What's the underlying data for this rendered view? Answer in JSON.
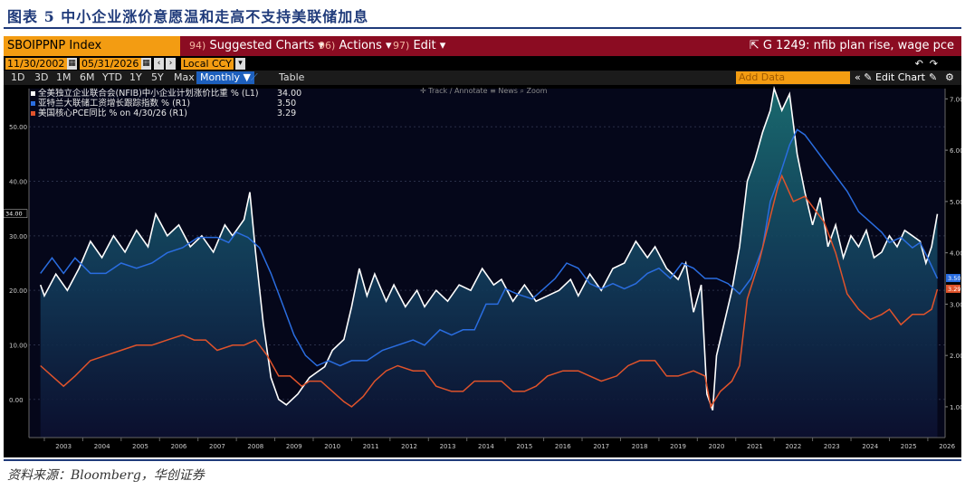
{
  "figure_title": "图表 5 中小企业涨价意愿温和走高不支持美联储加息",
  "source": "资料来源：Bloomberg，华创证券",
  "toolbar": {
    "ticker": "SBOIPPNP Index",
    "menu": [
      {
        "num": "94)",
        "label": "Suggested Charts ▾"
      },
      {
        "num": "96)",
        "label": "Actions ▾"
      },
      {
        "num": "97)",
        "label": "Edit ▾"
      }
    ],
    "chart_id": "G 1249: nfib plan rise, wage pce",
    "start_date": "11/30/2002",
    "end_date": "05/31/2026",
    "currency": "Local CCY",
    "periods": [
      "1D",
      "3D",
      "1M",
      "6M",
      "YTD",
      "1Y",
      "5Y",
      "Max"
    ],
    "frequency": "Monthly ▼",
    "table_label": "Table",
    "add_data": "Add Data",
    "edit_chart": "« ✎ Edit Chart",
    "tools": "✛ Track   ∕ Annotate   ≡ News   ⌕ Zoom"
  },
  "chart_data": {
    "type": "line",
    "x_unit": "date",
    "x_ticks": [
      "2003",
      "2004",
      "2005",
      "2006",
      "2007",
      "2008",
      "2009",
      "2010",
      "2011",
      "2012",
      "2013",
      "2014",
      "2015",
      "2016",
      "2017",
      "2018",
      "2019",
      "2020",
      "2021",
      "2022",
      "2023",
      "2024",
      "2025",
      "2026"
    ],
    "y_left": {
      "ticks": [
        "0.00",
        "10.00",
        "20.00",
        "30.00",
        "40.00",
        "50.00"
      ],
      "range": [
        -7,
        57
      ]
    },
    "y_right": {
      "ticks": [
        "1.00",
        "2.00",
        "3.00",
        "4.00",
        "5.00",
        "6.00",
        "7.00"
      ],
      "range": [
        0.4,
        7.2
      ]
    },
    "series": [
      {
        "name": "全美独立企业联合会(NFIB)中小企业计划涨价比重 % (L1)",
        "last": "34.00",
        "axis": "left",
        "color": "#ffffff",
        "area": true,
        "points": [
          [
            2002.9,
            21
          ],
          [
            2003.0,
            19
          ],
          [
            2003.3,
            23
          ],
          [
            2003.6,
            20
          ],
          [
            2003.9,
            24
          ],
          [
            2004.2,
            29
          ],
          [
            2004.5,
            26
          ],
          [
            2004.8,
            30
          ],
          [
            2005.1,
            27
          ],
          [
            2005.4,
            31
          ],
          [
            2005.7,
            28
          ],
          [
            2005.9,
            34
          ],
          [
            2006.2,
            30
          ],
          [
            2006.5,
            32
          ],
          [
            2006.8,
            28
          ],
          [
            2007.1,
            30
          ],
          [
            2007.4,
            27
          ],
          [
            2007.7,
            32
          ],
          [
            2007.9,
            30
          ],
          [
            2008.2,
            33
          ],
          [
            2008.35,
            38
          ],
          [
            2008.5,
            27
          ],
          [
            2008.7,
            14
          ],
          [
            2008.9,
            4
          ],
          [
            2009.1,
            0
          ],
          [
            2009.3,
            -1
          ],
          [
            2009.6,
            1
          ],
          [
            2009.9,
            4
          ],
          [
            2010.1,
            5
          ],
          [
            2010.3,
            6
          ],
          [
            2010.5,
            9
          ],
          [
            2010.8,
            11
          ],
          [
            2011.0,
            17
          ],
          [
            2011.2,
            24
          ],
          [
            2011.4,
            19
          ],
          [
            2011.6,
            23
          ],
          [
            2011.9,
            18
          ],
          [
            2012.1,
            21
          ],
          [
            2012.4,
            17
          ],
          [
            2012.7,
            20
          ],
          [
            2012.9,
            17
          ],
          [
            2013.2,
            20
          ],
          [
            2013.5,
            18
          ],
          [
            2013.8,
            21
          ],
          [
            2014.1,
            20
          ],
          [
            2014.4,
            24
          ],
          [
            2014.7,
            21
          ],
          [
            2014.9,
            22
          ],
          [
            2015.2,
            18
          ],
          [
            2015.5,
            21
          ],
          [
            2015.8,
            18
          ],
          [
            2016.1,
            19
          ],
          [
            2016.4,
            20
          ],
          [
            2016.7,
            22
          ],
          [
            2016.9,
            19
          ],
          [
            2017.2,
            23
          ],
          [
            2017.5,
            20
          ],
          [
            2017.8,
            24
          ],
          [
            2018.1,
            25
          ],
          [
            2018.4,
            29
          ],
          [
            2018.7,
            26
          ],
          [
            2018.9,
            28
          ],
          [
            2019.2,
            24
          ],
          [
            2019.5,
            22
          ],
          [
            2019.7,
            25
          ],
          [
            2019.9,
            16
          ],
          [
            2020.1,
            21
          ],
          [
            2020.25,
            1
          ],
          [
            2020.4,
            -2
          ],
          [
            2020.5,
            8
          ],
          [
            2020.7,
            14
          ],
          [
            2020.9,
            20
          ],
          [
            2021.1,
            28
          ],
          [
            2021.3,
            40
          ],
          [
            2021.5,
            44
          ],
          [
            2021.7,
            49
          ],
          [
            2021.9,
            53
          ],
          [
            2022.0,
            57
          ],
          [
            2022.2,
            53
          ],
          [
            2022.4,
            56
          ],
          [
            2022.6,
            45
          ],
          [
            2022.8,
            38
          ],
          [
            2023.0,
            32
          ],
          [
            2023.2,
            37
          ],
          [
            2023.4,
            28
          ],
          [
            2023.6,
            32
          ],
          [
            2023.8,
            26
          ],
          [
            2024.0,
            30
          ],
          [
            2024.2,
            28
          ],
          [
            2024.4,
            31
          ],
          [
            2024.6,
            26
          ],
          [
            2024.8,
            27
          ],
          [
            2025.0,
            30
          ],
          [
            2025.2,
            28
          ],
          [
            2025.4,
            31
          ],
          [
            2025.6,
            30
          ],
          [
            2025.8,
            29
          ],
          [
            2025.95,
            25
          ],
          [
            2026.1,
            28
          ],
          [
            2026.25,
            34
          ]
        ]
      },
      {
        "name": "亚特兰大联储工资增长跟踪指数 % (R1)",
        "last": "3.50",
        "axis": "right",
        "color": "#2a6de0",
        "points": [
          [
            2002.9,
            3.6
          ],
          [
            2003.2,
            3.9
          ],
          [
            2003.5,
            3.6
          ],
          [
            2003.8,
            3.9
          ],
          [
            2004.2,
            3.6
          ],
          [
            2004.6,
            3.6
          ],
          [
            2005.0,
            3.8
          ],
          [
            2005.4,
            3.7
          ],
          [
            2005.8,
            3.8
          ],
          [
            2006.2,
            4.0
          ],
          [
            2006.6,
            4.1
          ],
          [
            2007.0,
            4.3
          ],
          [
            2007.5,
            4.3
          ],
          [
            2007.8,
            4.2
          ],
          [
            2008.0,
            4.4
          ],
          [
            2008.3,
            4.3
          ],
          [
            2008.6,
            4.1
          ],
          [
            2008.9,
            3.6
          ],
          [
            2009.2,
            3.0
          ],
          [
            2009.5,
            2.4
          ],
          [
            2009.8,
            2.0
          ],
          [
            2010.1,
            1.8
          ],
          [
            2010.4,
            1.9
          ],
          [
            2010.7,
            1.8
          ],
          [
            2011.0,
            1.9
          ],
          [
            2011.4,
            1.9
          ],
          [
            2011.8,
            2.1
          ],
          [
            2012.2,
            2.2
          ],
          [
            2012.6,
            2.3
          ],
          [
            2012.9,
            2.2
          ],
          [
            2013.3,
            2.5
          ],
          [
            2013.6,
            2.4
          ],
          [
            2013.9,
            2.5
          ],
          [
            2014.2,
            2.5
          ],
          [
            2014.5,
            3.0
          ],
          [
            2014.8,
            3.0
          ],
          [
            2015.0,
            3.3
          ],
          [
            2015.3,
            3.2
          ],
          [
            2015.7,
            3.1
          ],
          [
            2016.0,
            3.3
          ],
          [
            2016.3,
            3.5
          ],
          [
            2016.6,
            3.8
          ],
          [
            2016.9,
            3.7
          ],
          [
            2017.2,
            3.4
          ],
          [
            2017.5,
            3.3
          ],
          [
            2017.8,
            3.4
          ],
          [
            2018.1,
            3.3
          ],
          [
            2018.4,
            3.4
          ],
          [
            2018.7,
            3.6
          ],
          [
            2019.0,
            3.7
          ],
          [
            2019.3,
            3.5
          ],
          [
            2019.6,
            3.8
          ],
          [
            2019.9,
            3.7
          ],
          [
            2020.2,
            3.5
          ],
          [
            2020.5,
            3.5
          ],
          [
            2020.8,
            3.4
          ],
          [
            2021.1,
            3.2
          ],
          [
            2021.4,
            3.5
          ],
          [
            2021.7,
            4.1
          ],
          [
            2021.9,
            5.0
          ],
          [
            2022.1,
            5.4
          ],
          [
            2022.4,
            6.1
          ],
          [
            2022.6,
            6.4
          ],
          [
            2022.8,
            6.3
          ],
          [
            2023.0,
            6.1
          ],
          [
            2023.3,
            5.8
          ],
          [
            2023.6,
            5.5
          ],
          [
            2023.9,
            5.2
          ],
          [
            2024.2,
            4.8
          ],
          [
            2024.5,
            4.6
          ],
          [
            2024.8,
            4.4
          ],
          [
            2025.0,
            4.2
          ],
          [
            2025.3,
            4.3
          ],
          [
            2025.6,
            4.1
          ],
          [
            2025.8,
            4.2
          ],
          [
            2026.0,
            3.9
          ],
          [
            2026.25,
            3.5
          ]
        ]
      },
      {
        "name": "美国核心PCE同比 % on 4/30/26 (R1)",
        "last": "3.29",
        "axis": "right",
        "color": "#e0532b",
        "points": [
          [
            2002.9,
            1.8
          ],
          [
            2003.2,
            1.6
          ],
          [
            2003.5,
            1.4
          ],
          [
            2003.8,
            1.6
          ],
          [
            2004.2,
            1.9
          ],
          [
            2004.6,
            2.0
          ],
          [
            2005.0,
            2.1
          ],
          [
            2005.4,
            2.2
          ],
          [
            2005.8,
            2.2
          ],
          [
            2006.2,
            2.3
          ],
          [
            2006.6,
            2.4
          ],
          [
            2006.9,
            2.3
          ],
          [
            2007.2,
            2.3
          ],
          [
            2007.5,
            2.1
          ],
          [
            2007.9,
            2.2
          ],
          [
            2008.2,
            2.2
          ],
          [
            2008.5,
            2.3
          ],
          [
            2008.8,
            2.0
          ],
          [
            2009.1,
            1.6
          ],
          [
            2009.4,
            1.6
          ],
          [
            2009.7,
            1.4
          ],
          [
            2009.9,
            1.5
          ],
          [
            2010.2,
            1.5
          ],
          [
            2010.5,
            1.3
          ],
          [
            2010.8,
            1.1
          ],
          [
            2011.0,
            1.0
          ],
          [
            2011.3,
            1.2
          ],
          [
            2011.6,
            1.5
          ],
          [
            2011.9,
            1.7
          ],
          [
            2012.2,
            1.8
          ],
          [
            2012.6,
            1.7
          ],
          [
            2012.9,
            1.7
          ],
          [
            2013.2,
            1.4
          ],
          [
            2013.6,
            1.3
          ],
          [
            2013.9,
            1.3
          ],
          [
            2014.2,
            1.5
          ],
          [
            2014.6,
            1.5
          ],
          [
            2014.9,
            1.5
          ],
          [
            2015.2,
            1.3
          ],
          [
            2015.5,
            1.3
          ],
          [
            2015.8,
            1.4
          ],
          [
            2016.1,
            1.6
          ],
          [
            2016.5,
            1.7
          ],
          [
            2016.9,
            1.7
          ],
          [
            2017.2,
            1.6
          ],
          [
            2017.5,
            1.5
          ],
          [
            2017.9,
            1.6
          ],
          [
            2018.2,
            1.8
          ],
          [
            2018.5,
            1.9
          ],
          [
            2018.9,
            1.9
          ],
          [
            2019.2,
            1.6
          ],
          [
            2019.5,
            1.6
          ],
          [
            2019.9,
            1.7
          ],
          [
            2020.2,
            1.6
          ],
          [
            2020.35,
            1.0
          ],
          [
            2020.6,
            1.3
          ],
          [
            2020.9,
            1.5
          ],
          [
            2021.1,
            1.8
          ],
          [
            2021.3,
            3.1
          ],
          [
            2021.6,
            3.8
          ],
          [
            2021.9,
            4.7
          ],
          [
            2022.1,
            5.3
          ],
          [
            2022.2,
            5.5
          ],
          [
            2022.5,
            5.0
          ],
          [
            2022.8,
            5.1
          ],
          [
            2023.0,
            4.9
          ],
          [
            2023.3,
            4.6
          ],
          [
            2023.6,
            4.0
          ],
          [
            2023.9,
            3.2
          ],
          [
            2024.2,
            2.9
          ],
          [
            2024.5,
            2.7
          ],
          [
            2024.8,
            2.8
          ],
          [
            2025.0,
            2.9
          ],
          [
            2025.3,
            2.6
          ],
          [
            2025.6,
            2.8
          ],
          [
            2025.9,
            2.8
          ],
          [
            2026.1,
            2.9
          ],
          [
            2026.25,
            3.29
          ]
        ]
      }
    ]
  }
}
